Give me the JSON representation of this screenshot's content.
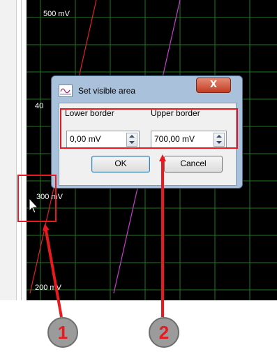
{
  "scope": {
    "y_labels": [
      "500 mV",
      "40",
      "300 mV",
      "200 mV"
    ],
    "colors": {
      "grid": "#1f7a1f",
      "trace_red": "#e0202a",
      "trace_magenta": "#c83cd0",
      "background": "#000000"
    }
  },
  "dialog": {
    "title": "Set visible area",
    "close_label": "X",
    "lower_label": "Lower border",
    "upper_label": "Upper border",
    "lower_value": "0,00 mV",
    "upper_value": "700,00 mV",
    "ok_label": "OK",
    "cancel_label": "Cancel"
  },
  "annotations": {
    "badge_1": "1",
    "badge_2": "2",
    "highlight_color": "#e8191f"
  },
  "icons": [
    "waveform-icon",
    "mouse-cursor-icon",
    "spin-up-icon",
    "spin-down-icon"
  ]
}
